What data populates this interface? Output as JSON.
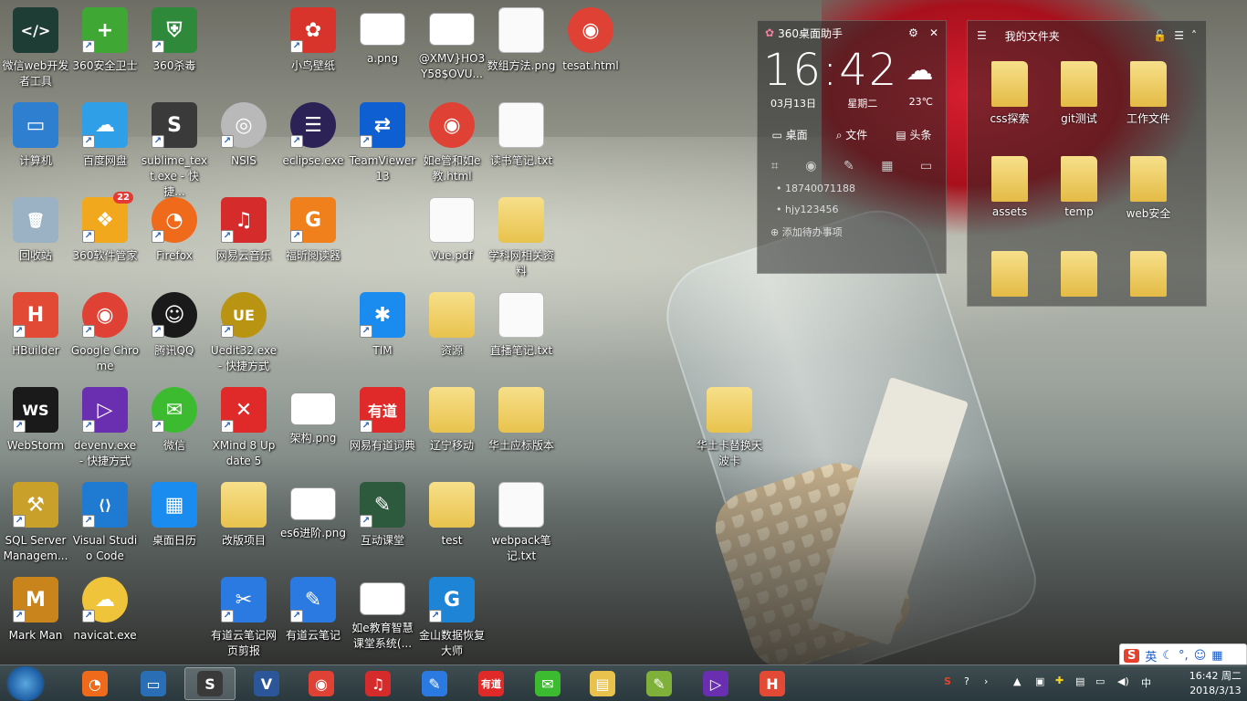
{
  "desktop_icons": [
    {
      "label": "微信web开发者工具",
      "col": 0,
      "row": 0,
      "color": "#1e3d35",
      "glyph": "</>",
      "shortcut": false
    },
    {
      "label": "360安全卫士",
      "col": 1,
      "row": 0,
      "color": "#3fa834",
      "glyph": "+",
      "shortcut": true
    },
    {
      "label": "360杀毒",
      "col": 2,
      "row": 0,
      "color": "#2e8a3a",
      "glyph": "⛨",
      "shortcut": true
    },
    {
      "label": "小鸟壁纸",
      "col": 4,
      "row": 0,
      "color": "#d9342c",
      "glyph": "✿",
      "shortcut": true
    },
    {
      "label": "a.png",
      "col": 5,
      "row": 0,
      "kind": "shot"
    },
    {
      "label": "@XMV}HO3Y58$OVU...",
      "col": 6,
      "row": 0,
      "kind": "shot"
    },
    {
      "label": "数组方法.png",
      "col": 7,
      "row": 0,
      "kind": "doc"
    },
    {
      "label": "tesat.html",
      "col": 8,
      "row": 0,
      "color": "#e04135",
      "glyph": "◉",
      "round": true
    },
    {
      "label": "计算机",
      "col": 0,
      "row": 1,
      "color": "#2f7fd1",
      "glyph": "▭"
    },
    {
      "label": "百度网盘",
      "col": 1,
      "row": 1,
      "color": "#2fa0e8",
      "glyph": "☁",
      "shortcut": true
    },
    {
      "label": "sublime_text.exe - 快捷...",
      "col": 2,
      "row": 1,
      "color": "#3a3a3a",
      "glyph": "S",
      "shortcut": true
    },
    {
      "label": "NSIS",
      "col": 3,
      "row": 1,
      "color": "#b9b9b9",
      "glyph": "◎",
      "shortcut": true,
      "round": true
    },
    {
      "label": "eclipse.exe",
      "col": 4,
      "row": 1,
      "color": "#2c2255",
      "glyph": "☰",
      "shortcut": true,
      "round": true
    },
    {
      "label": "TeamViewer 13",
      "col": 5,
      "row": 1,
      "color": "#0e5fd1",
      "glyph": "⇄",
      "shortcut": true
    },
    {
      "label": "如e管和如e教.html",
      "col": 6,
      "row": 1,
      "color": "#e04135",
      "glyph": "◉",
      "round": true
    },
    {
      "label": "读书笔记.txt",
      "col": 7,
      "row": 1,
      "kind": "doc"
    },
    {
      "label": "回收站",
      "col": 0,
      "row": 2,
      "color": "#9ab2c4",
      "glyph": "🗑"
    },
    {
      "label": "360软件管家",
      "col": 1,
      "row": 2,
      "color": "#f2a81c",
      "glyph": "❖",
      "shortcut": true,
      "badge": "22"
    },
    {
      "label": "Firefox",
      "col": 2,
      "row": 2,
      "color": "#f06a1b",
      "glyph": "◔",
      "shortcut": true,
      "round": true
    },
    {
      "label": "网易云音乐",
      "col": 3,
      "row": 2,
      "color": "#d62b2b",
      "glyph": "♫",
      "shortcut": true
    },
    {
      "label": "福昕阅读器",
      "col": 4,
      "row": 2,
      "color": "#f0801c",
      "glyph": "G",
      "shortcut": true
    },
    {
      "label": "Vue.pdf",
      "col": 6,
      "row": 2,
      "kind": "doc"
    },
    {
      "label": "学科网相关资料",
      "col": 7,
      "row": 2,
      "kind": "folder"
    },
    {
      "label": "HBuilder",
      "col": 0,
      "row": 3,
      "color": "#e24a36",
      "glyph": "H",
      "shortcut": true
    },
    {
      "label": "Google Chrome",
      "col": 1,
      "row": 3,
      "color": "#e04135",
      "glyph": "◉",
      "shortcut": true,
      "round": true
    },
    {
      "label": "腾讯QQ",
      "col": 2,
      "row": 3,
      "color": "#1a1a1a",
      "glyph": "☺",
      "shortcut": true,
      "round": true
    },
    {
      "label": "Uedit32.exe - 快捷方式",
      "col": 3,
      "row": 3,
      "color": "#b99312",
      "glyph": "UE",
      "shortcut": true,
      "round": true
    },
    {
      "label": "TIM",
      "col": 5,
      "row": 3,
      "color": "#1a8cf0",
      "glyph": "✱",
      "shortcut": true
    },
    {
      "label": "资源",
      "col": 6,
      "row": 3,
      "kind": "folder"
    },
    {
      "label": "直播笔记.txt",
      "col": 7,
      "row": 3,
      "kind": "doc"
    },
    {
      "label": "WebStorm",
      "col": 0,
      "row": 4,
      "color": "#1a1a1a",
      "glyph": "WS",
      "shortcut": true
    },
    {
      "label": "devenv.exe - 快捷方式",
      "col": 1,
      "row": 4,
      "color": "#6a2fb0",
      "glyph": "▷",
      "shortcut": true
    },
    {
      "label": "微信",
      "col": 2,
      "row": 4,
      "color": "#3dbb30",
      "glyph": "✉",
      "shortcut": true,
      "round": true
    },
    {
      "label": "XMind 8 Update 5",
      "col": 3,
      "row": 4,
      "color": "#e02a2a",
      "glyph": "✕",
      "shortcut": true
    },
    {
      "label": "架构.png",
      "col": 4,
      "row": 4,
      "kind": "shot"
    },
    {
      "label": "网易有道词典",
      "col": 5,
      "row": 4,
      "color": "#e02a2a",
      "glyph": "有道",
      "shortcut": true
    },
    {
      "label": "辽宁移动",
      "col": 6,
      "row": 4,
      "kind": "folder"
    },
    {
      "label": "华土应标版本",
      "col": 7,
      "row": 4,
      "kind": "folder"
    },
    {
      "label": "华土卡替换天波卡",
      "col": 10,
      "row": 4,
      "kind": "folder"
    },
    {
      "label": "SQL Server Managem...",
      "col": 0,
      "row": 5,
      "color": "#c9a02a",
      "glyph": "⚒",
      "shortcut": true
    },
    {
      "label": "Visual Studio Code",
      "col": 1,
      "row": 5,
      "color": "#1f7ad1",
      "glyph": "⟨⟩",
      "shortcut": true
    },
    {
      "label": "桌面日历",
      "col": 2,
      "row": 5,
      "color": "#1a8cf0",
      "glyph": "▦"
    },
    {
      "label": "改版项目",
      "col": 3,
      "row": 5,
      "kind": "folder"
    },
    {
      "label": "es6进阶.png",
      "col": 4,
      "row": 5,
      "kind": "shot"
    },
    {
      "label": "互动课堂",
      "col": 5,
      "row": 5,
      "color": "#2d5a3d",
      "glyph": "✎",
      "shortcut": true
    },
    {
      "label": "test",
      "col": 6,
      "row": 5,
      "kind": "folder"
    },
    {
      "label": "webpack笔记.txt",
      "col": 7,
      "row": 5,
      "kind": "doc"
    },
    {
      "label": "Mark Man",
      "col": 0,
      "row": 6,
      "color": "#c9841c",
      "glyph": "M",
      "shortcut": true
    },
    {
      "label": "navicat.exe",
      "col": 1,
      "row": 6,
      "color": "#f0c43a",
      "glyph": "☁",
      "shortcut": true,
      "round": true
    },
    {
      "label": "有道云笔记网页剪报",
      "col": 3,
      "row": 6,
      "color": "#2a7ae2",
      "glyph": "✂",
      "shortcut": true
    },
    {
      "label": "有道云笔记",
      "col": 4,
      "row": 6,
      "color": "#2a7ae2",
      "glyph": "✎",
      "shortcut": true
    },
    {
      "label": "如e教育智慧课堂系统(...",
      "col": 5,
      "row": 6,
      "kind": "shot"
    },
    {
      "label": "金山数据恢复大师",
      "col": 6,
      "row": 6,
      "color": "#1d84d6",
      "glyph": "G",
      "shortcut": true
    }
  ],
  "widget": {
    "title": "360桌面助手",
    "time": "16:42",
    "date": "03月13日",
    "weekday": "星期二",
    "temp": "23℃",
    "tabs": [
      "桌面",
      "文件",
      "头条"
    ],
    "todos": [
      "18740071188",
      "hjy123456"
    ],
    "add_todo": "添加待办事项"
  },
  "folder_window": {
    "title": "我的文件夹",
    "items": [
      "css探索",
      "git测试",
      "工作文件",
      "assets",
      "temp",
      "web安全"
    ]
  },
  "taskbar": {
    "apps": [
      {
        "name": "firefox",
        "color": "#f06a1b",
        "glyph": "◔"
      },
      {
        "name": "remote",
        "color": "#2a6fb5",
        "glyph": "▭"
      },
      {
        "name": "sublime",
        "color": "#3a3a3a",
        "glyph": "S",
        "active": true
      },
      {
        "name": "word",
        "color": "#2b579a",
        "glyph": "V"
      },
      {
        "name": "chrome",
        "color": "#e04135",
        "glyph": "◉"
      },
      {
        "name": "netease-music",
        "color": "#d62b2b",
        "glyph": "♫"
      },
      {
        "name": "youdao-note",
        "color": "#2a7ae2",
        "glyph": "✎"
      },
      {
        "name": "youdao-dict",
        "color": "#e02a2a",
        "glyph": "有道"
      },
      {
        "name": "wechat",
        "color": "#3dbb30",
        "glyph": "✉"
      },
      {
        "name": "explorer",
        "color": "#e8c24d",
        "glyph": "▤"
      },
      {
        "name": "notepad++",
        "color": "#7fb03a",
        "glyph": "✎"
      },
      {
        "name": "visual-studio",
        "color": "#6a2fb0",
        "glyph": "▷"
      },
      {
        "name": "hbuilder",
        "color": "#e24a36",
        "glyph": "H"
      }
    ],
    "clock_time": "16:42 周二",
    "clock_date": "2018/3/13",
    "ime_label": "英"
  }
}
